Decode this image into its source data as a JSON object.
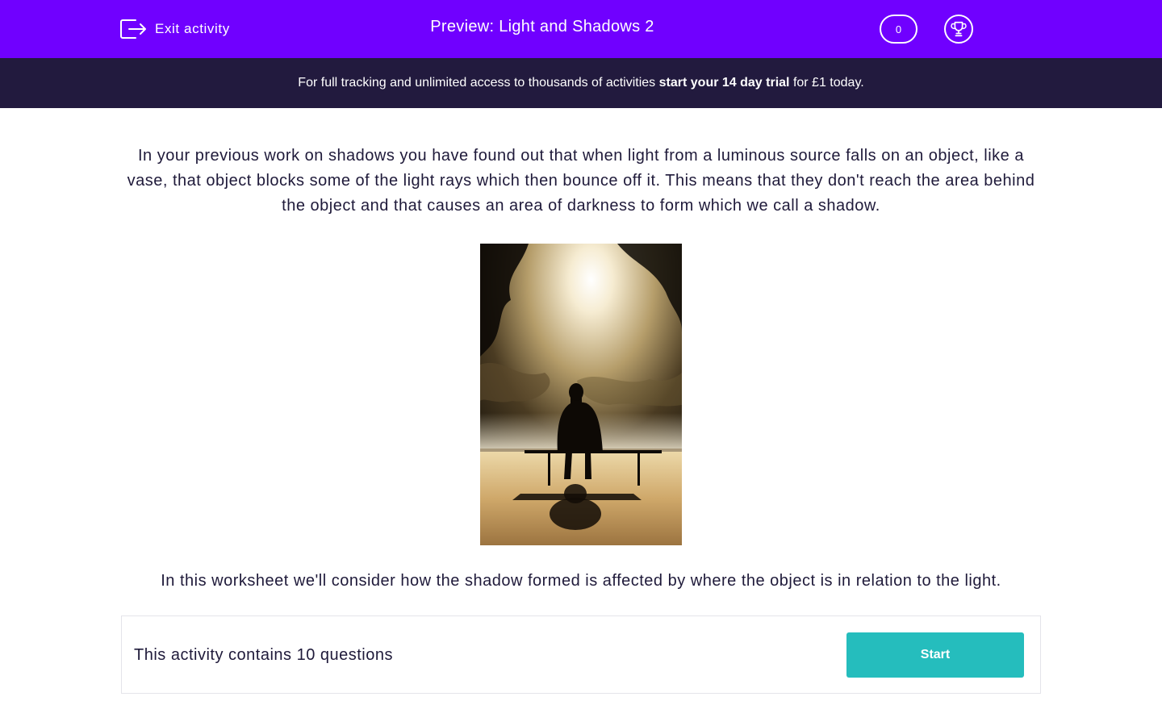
{
  "header": {
    "exit_label": "Exit activity",
    "title": "Preview: Light and Shadows 2",
    "score": "0",
    "exit_icon": "exit-icon",
    "trophy_icon": "trophy-icon"
  },
  "promo": {
    "text_before": "For full tracking and unlimited access to thousands of activities",
    "text_strong": "start your 14 day trial",
    "text_after": "for £1 today."
  },
  "content": {
    "intro": "In your previous work on shadows you have found out that when light from a luminous source falls on an object, like a vase, that object blocks some of the light rays which then bounce off it. This means that they don't reach the area behind the object and that causes an area of darkness to form which we call a shadow.",
    "image_description": "silhouette of a person sitting on a bench with shadow",
    "outro": "In this worksheet we'll consider how the shadow formed is affected by where the object is in relation to the light."
  },
  "activity": {
    "question_count_text": "This activity contains 10 questions",
    "start_label": "Start"
  },
  "colors": {
    "header_bg": "#7000ff",
    "promo_bg": "#221a3e",
    "start_button": "#25bdbd",
    "body_text": "#1f1a3a"
  }
}
